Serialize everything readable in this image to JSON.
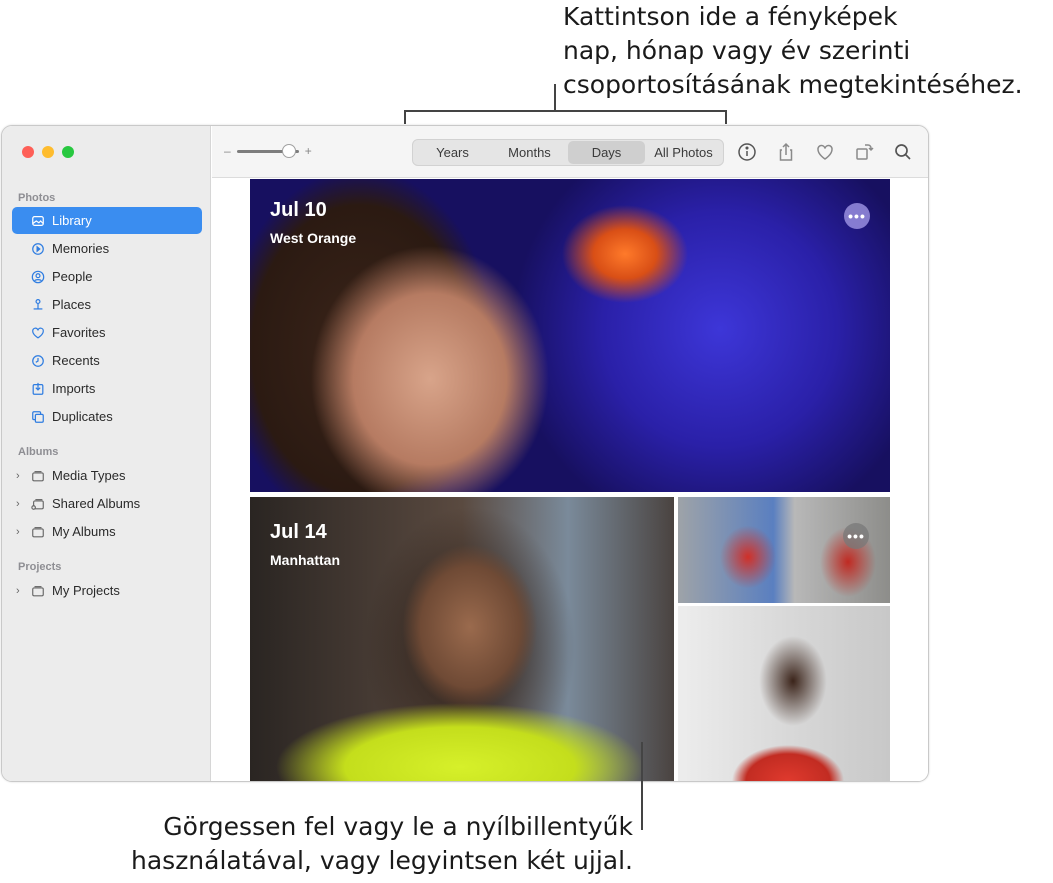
{
  "callouts": {
    "top": [
      "Kattintson ide a fényképek",
      "nap, hónap vagy év szerinti",
      "csoportosításának megtekintéséhez."
    ],
    "bottom": [
      "Görgessen fel vagy le a nyílbillentyűk",
      "használatával, vagy legyintsen két ujjal."
    ]
  },
  "sidebar": {
    "sections": [
      {
        "label": "Photos"
      },
      {
        "label": "Albums"
      },
      {
        "label": "Projects"
      }
    ],
    "library_items": [
      {
        "label": "Library",
        "icon": "library-icon",
        "active": true
      },
      {
        "label": "Memories",
        "icon": "memories-icon"
      },
      {
        "label": "People",
        "icon": "people-icon"
      },
      {
        "label": "Places",
        "icon": "places-icon"
      },
      {
        "label": "Favorites",
        "icon": "heart-icon"
      },
      {
        "label": "Recents",
        "icon": "clock-icon"
      },
      {
        "label": "Imports",
        "icon": "import-icon"
      },
      {
        "label": "Duplicates",
        "icon": "duplicates-icon"
      }
    ],
    "album_items": [
      {
        "label": "Media Types",
        "icon": "folder-icon"
      },
      {
        "label": "Shared Albums",
        "icon": "shared-folder-icon"
      },
      {
        "label": "My Albums",
        "icon": "folder-icon"
      }
    ],
    "project_items": [
      {
        "label": "My Projects",
        "icon": "folder-icon"
      }
    ]
  },
  "toolbar": {
    "zoom_minus": "–",
    "zoom_plus": "+",
    "zoom_level": 0.85,
    "segments": [
      "Years",
      "Months",
      "Days",
      "All Photos"
    ],
    "selected_segment": "Days",
    "tools": [
      "info-icon",
      "share-icon",
      "heart-icon",
      "rotate-icon",
      "search-icon"
    ]
  },
  "cards": [
    {
      "date": "Jul 10",
      "place": "West Orange",
      "more": "•••"
    },
    {
      "date": "Jul 14",
      "place": "Manhattan",
      "more": "•••"
    }
  ],
  "colors": {
    "accent": "#3a8df0",
    "sidebar_bg": "#ececec",
    "traffic_red": "#fe5f57",
    "traffic_yellow": "#febc2e",
    "traffic_green": "#28c840"
  }
}
